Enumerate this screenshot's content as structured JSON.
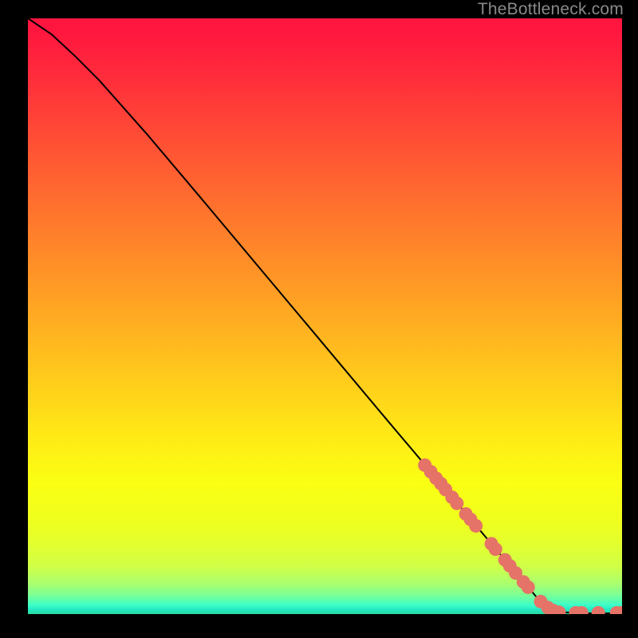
{
  "watermark": "TheBottleneck.com",
  "colors": {
    "page_bg": "#000000",
    "curve_stroke": "#000000",
    "dot_fill": "#e57367",
    "watermark": "#88898b"
  },
  "chart_data": {
    "type": "line",
    "title": "",
    "xlabel": "",
    "ylabel": "",
    "xlim": [
      0,
      100
    ],
    "ylim": [
      0,
      100
    ],
    "grid": false,
    "curve": [
      {
        "x": 0,
        "y": 100
      },
      {
        "x": 4,
        "y": 97.3
      },
      {
        "x": 8,
        "y": 93.6
      },
      {
        "x": 12,
        "y": 89.6
      },
      {
        "x": 20,
        "y": 80.6
      },
      {
        "x": 30,
        "y": 68.8
      },
      {
        "x": 40,
        "y": 56.9
      },
      {
        "x": 50,
        "y": 45.0
      },
      {
        "x": 60,
        "y": 33.1
      },
      {
        "x": 70,
        "y": 21.3
      },
      {
        "x": 78,
        "y": 11.8
      },
      {
        "x": 83,
        "y": 5.9
      },
      {
        "x": 86,
        "y": 2.4
      },
      {
        "x": 88,
        "y": 0.9
      },
      {
        "x": 90,
        "y": 0.3
      },
      {
        "x": 94,
        "y": 0.15
      },
      {
        "x": 100,
        "y": 0.1
      }
    ],
    "series": [
      {
        "name": "dots",
        "points": [
          {
            "x": 66.8,
            "y": 25.0
          },
          {
            "x": 67.8,
            "y": 23.9
          },
          {
            "x": 68.7,
            "y": 22.8
          },
          {
            "x": 69.5,
            "y": 21.9
          },
          {
            "x": 70.3,
            "y": 20.9
          },
          {
            "x": 71.4,
            "y": 19.6
          },
          {
            "x": 72.2,
            "y": 18.6
          },
          {
            "x": 73.7,
            "y": 16.8
          },
          {
            "x": 74.5,
            "y": 15.9
          },
          {
            "x": 75.4,
            "y": 14.8
          },
          {
            "x": 78.0,
            "y": 11.8
          },
          {
            "x": 78.7,
            "y": 10.9
          },
          {
            "x": 80.3,
            "y": 9.1
          },
          {
            "x": 81.1,
            "y": 8.1
          },
          {
            "x": 82.1,
            "y": 6.9
          },
          {
            "x": 83.4,
            "y": 5.4
          },
          {
            "x": 84.2,
            "y": 4.5
          },
          {
            "x": 86.3,
            "y": 2.1
          },
          {
            "x": 87.5,
            "y": 1.1
          },
          {
            "x": 88.4,
            "y": 0.6
          },
          {
            "x": 89.4,
            "y": 0.3
          },
          {
            "x": 92.2,
            "y": 0.2
          },
          {
            "x": 93.2,
            "y": 0.2
          },
          {
            "x": 96.0,
            "y": 0.2
          },
          {
            "x": 99.1,
            "y": 0.2
          },
          {
            "x": 100.0,
            "y": 0.2
          }
        ]
      }
    ]
  }
}
